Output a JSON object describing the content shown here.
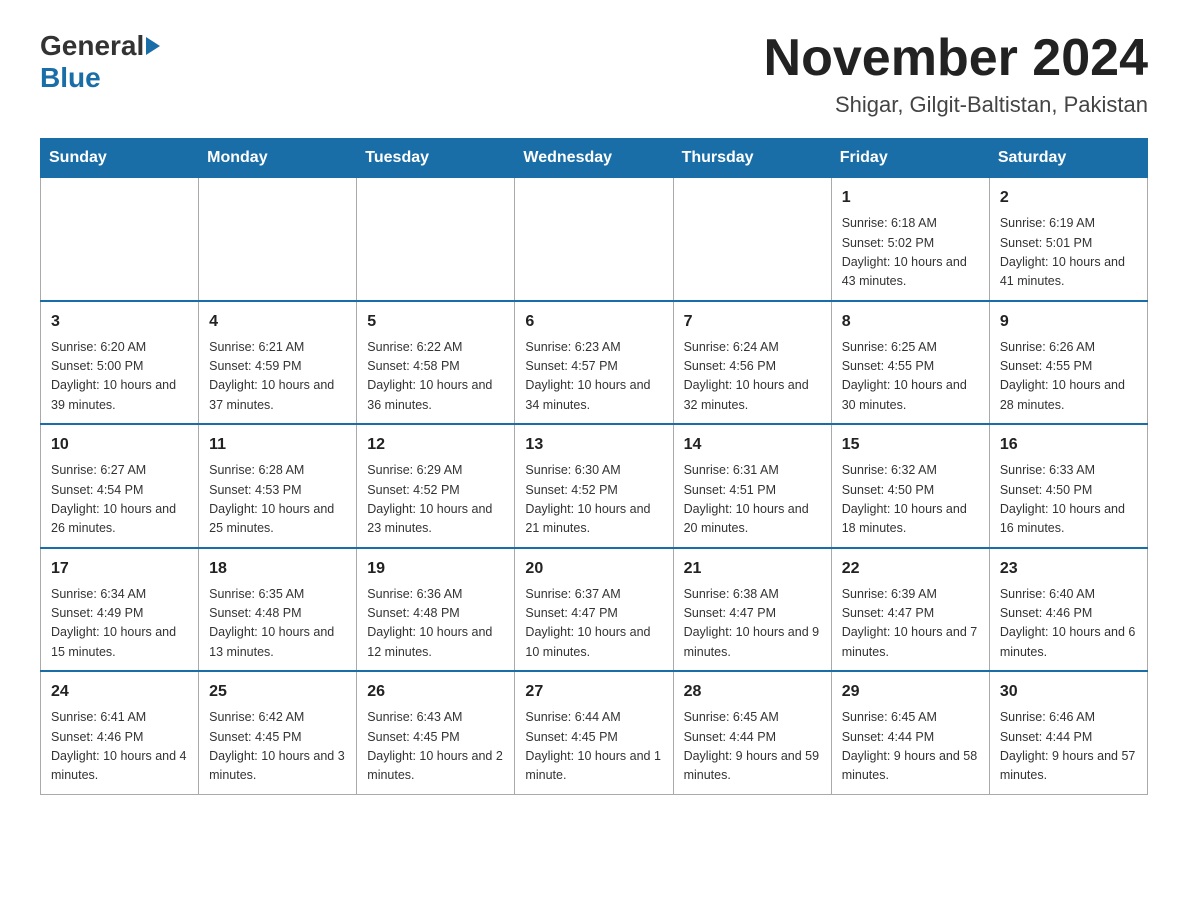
{
  "header": {
    "logo_general": "General",
    "logo_blue": "Blue",
    "month_title": "November 2024",
    "location": "Shigar, Gilgit-Baltistan, Pakistan"
  },
  "days_of_week": [
    "Sunday",
    "Monday",
    "Tuesday",
    "Wednesday",
    "Thursday",
    "Friday",
    "Saturday"
  ],
  "weeks": [
    [
      {
        "day": "",
        "info": ""
      },
      {
        "day": "",
        "info": ""
      },
      {
        "day": "",
        "info": ""
      },
      {
        "day": "",
        "info": ""
      },
      {
        "day": "",
        "info": ""
      },
      {
        "day": "1",
        "info": "Sunrise: 6:18 AM\nSunset: 5:02 PM\nDaylight: 10 hours and 43 minutes."
      },
      {
        "day": "2",
        "info": "Sunrise: 6:19 AM\nSunset: 5:01 PM\nDaylight: 10 hours and 41 minutes."
      }
    ],
    [
      {
        "day": "3",
        "info": "Sunrise: 6:20 AM\nSunset: 5:00 PM\nDaylight: 10 hours and 39 minutes."
      },
      {
        "day": "4",
        "info": "Sunrise: 6:21 AM\nSunset: 4:59 PM\nDaylight: 10 hours and 37 minutes."
      },
      {
        "day": "5",
        "info": "Sunrise: 6:22 AM\nSunset: 4:58 PM\nDaylight: 10 hours and 36 minutes."
      },
      {
        "day": "6",
        "info": "Sunrise: 6:23 AM\nSunset: 4:57 PM\nDaylight: 10 hours and 34 minutes."
      },
      {
        "day": "7",
        "info": "Sunrise: 6:24 AM\nSunset: 4:56 PM\nDaylight: 10 hours and 32 minutes."
      },
      {
        "day": "8",
        "info": "Sunrise: 6:25 AM\nSunset: 4:55 PM\nDaylight: 10 hours and 30 minutes."
      },
      {
        "day": "9",
        "info": "Sunrise: 6:26 AM\nSunset: 4:55 PM\nDaylight: 10 hours and 28 minutes."
      }
    ],
    [
      {
        "day": "10",
        "info": "Sunrise: 6:27 AM\nSunset: 4:54 PM\nDaylight: 10 hours and 26 minutes."
      },
      {
        "day": "11",
        "info": "Sunrise: 6:28 AM\nSunset: 4:53 PM\nDaylight: 10 hours and 25 minutes."
      },
      {
        "day": "12",
        "info": "Sunrise: 6:29 AM\nSunset: 4:52 PM\nDaylight: 10 hours and 23 minutes."
      },
      {
        "day": "13",
        "info": "Sunrise: 6:30 AM\nSunset: 4:52 PM\nDaylight: 10 hours and 21 minutes."
      },
      {
        "day": "14",
        "info": "Sunrise: 6:31 AM\nSunset: 4:51 PM\nDaylight: 10 hours and 20 minutes."
      },
      {
        "day": "15",
        "info": "Sunrise: 6:32 AM\nSunset: 4:50 PM\nDaylight: 10 hours and 18 minutes."
      },
      {
        "day": "16",
        "info": "Sunrise: 6:33 AM\nSunset: 4:50 PM\nDaylight: 10 hours and 16 minutes."
      }
    ],
    [
      {
        "day": "17",
        "info": "Sunrise: 6:34 AM\nSunset: 4:49 PM\nDaylight: 10 hours and 15 minutes."
      },
      {
        "day": "18",
        "info": "Sunrise: 6:35 AM\nSunset: 4:48 PM\nDaylight: 10 hours and 13 minutes."
      },
      {
        "day": "19",
        "info": "Sunrise: 6:36 AM\nSunset: 4:48 PM\nDaylight: 10 hours and 12 minutes."
      },
      {
        "day": "20",
        "info": "Sunrise: 6:37 AM\nSunset: 4:47 PM\nDaylight: 10 hours and 10 minutes."
      },
      {
        "day": "21",
        "info": "Sunrise: 6:38 AM\nSunset: 4:47 PM\nDaylight: 10 hours and 9 minutes."
      },
      {
        "day": "22",
        "info": "Sunrise: 6:39 AM\nSunset: 4:47 PM\nDaylight: 10 hours and 7 minutes."
      },
      {
        "day": "23",
        "info": "Sunrise: 6:40 AM\nSunset: 4:46 PM\nDaylight: 10 hours and 6 minutes."
      }
    ],
    [
      {
        "day": "24",
        "info": "Sunrise: 6:41 AM\nSunset: 4:46 PM\nDaylight: 10 hours and 4 minutes."
      },
      {
        "day": "25",
        "info": "Sunrise: 6:42 AM\nSunset: 4:45 PM\nDaylight: 10 hours and 3 minutes."
      },
      {
        "day": "26",
        "info": "Sunrise: 6:43 AM\nSunset: 4:45 PM\nDaylight: 10 hours and 2 minutes."
      },
      {
        "day": "27",
        "info": "Sunrise: 6:44 AM\nSunset: 4:45 PM\nDaylight: 10 hours and 1 minute."
      },
      {
        "day": "28",
        "info": "Sunrise: 6:45 AM\nSunset: 4:44 PM\nDaylight: 9 hours and 59 minutes."
      },
      {
        "day": "29",
        "info": "Sunrise: 6:45 AM\nSunset: 4:44 PM\nDaylight: 9 hours and 58 minutes."
      },
      {
        "day": "30",
        "info": "Sunrise: 6:46 AM\nSunset: 4:44 PM\nDaylight: 9 hours and 57 minutes."
      }
    ]
  ]
}
